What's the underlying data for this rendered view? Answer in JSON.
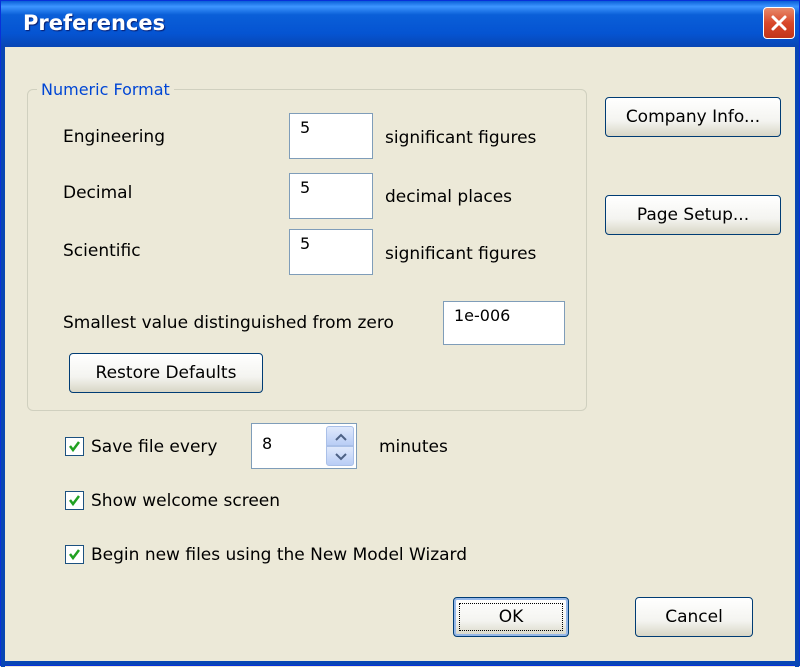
{
  "window": {
    "title": "Preferences"
  },
  "numeric_format": {
    "legend": "Numeric Format",
    "rows": [
      {
        "label": "Engineering",
        "value": "5",
        "unit": "significant figures"
      },
      {
        "label": "Decimal",
        "value": "5",
        "unit": "decimal places"
      },
      {
        "label": "Scientific",
        "value": "5",
        "unit": "significant figures"
      }
    ],
    "smallest_label": "Smallest value distinguished from zero",
    "smallest_value": "1e-006",
    "restore_label": "Restore Defaults"
  },
  "side_buttons": {
    "company_info": "Company Info...",
    "page_setup": "Page Setup..."
  },
  "options": {
    "save_label": "Save file every",
    "save_minutes": "8",
    "minutes_label": "minutes",
    "welcome_label": "Show welcome screen",
    "wizard_label": "Begin new files using the New Model Wizard",
    "save_checked": true,
    "welcome_checked": true,
    "wizard_checked": true
  },
  "footer": {
    "ok": "OK",
    "cancel": "Cancel"
  },
  "colors": {
    "titlebar": "#0554d2",
    "legend": "#0046d5",
    "close": "#d9482b",
    "check": "#21a121"
  }
}
